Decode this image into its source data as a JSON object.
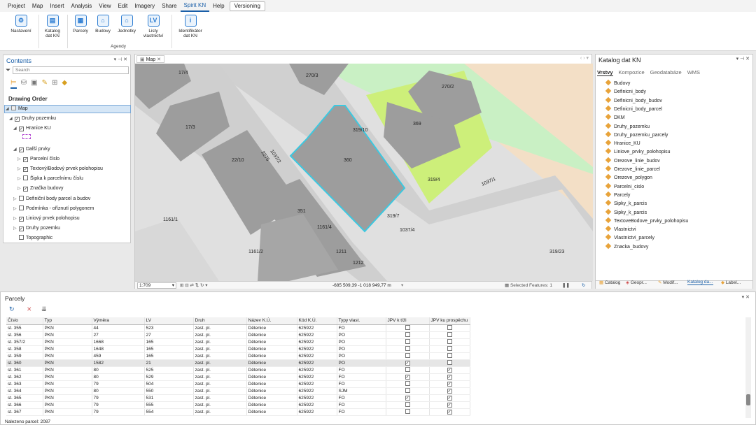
{
  "menu": [
    "Project",
    "Map",
    "Insert",
    "Analysis",
    "View",
    "Edit",
    "Imagery",
    "Share",
    "Spirit KN",
    "Help"
  ],
  "menu_active": "Spirit KN",
  "menu_extra": "Versioning",
  "ribbon": {
    "nastaveni": "Nastavení",
    "katalog": "Katalog dat KN",
    "parcely": "Parcely",
    "budovy": "Budovy",
    "jednotky": "Jednotky",
    "listy": "Listy vlastnictví",
    "identifikator": "Identifikátor dat KN",
    "group_agendy": "Agendy"
  },
  "contents": {
    "title": "Contents",
    "search_placeholder": "Search",
    "drawing_order": "Drawing Order",
    "items": {
      "map": "Map",
      "druhy": "Druhy pozemku",
      "hranice": "Hranice KU",
      "dalsi": "Další prvky",
      "parcelni": "Parcelní číslo",
      "textovy": "Textový/Bodový prvek polohopisu",
      "sipka": "Šipka k parcelnímu číslu",
      "znacka": "Značka budovy",
      "definicni": "Definiční body parcel a budov",
      "podminka": "Podmínka - oříznutí polygonem",
      "liniovy": "Liniový prvek polohopisu",
      "druhy2": "Druhy pozemku",
      "topo": "Topographic"
    }
  },
  "map": {
    "tab": "Map",
    "scale": "1:709",
    "coords": "-685 509,39 -1 018 949,77 m",
    "selected": "Selected Features: 1",
    "labels": [
      "17/4",
      "270/3",
      "270/2",
      "17/3",
      "369",
      "319/10",
      "1037/2",
      "22/10",
      "2275",
      "360",
      "319/4",
      "1037/1",
      "1161/1",
      "351",
      "319/7",
      "1037/4",
      "1161/4",
      "1161/2",
      "1211",
      "1212",
      "319/23"
    ]
  },
  "catalog": {
    "title": "Katalog dat KN",
    "tabs": [
      "Vrstvy",
      "Kompozice",
      "Geodatabáze",
      "WMS"
    ],
    "items": [
      "Budovy",
      "Definicni_body",
      "Definicni_body_budov",
      "Definicni_body_parcel",
      "DKM",
      "Druhy_pozemku",
      "Druhy_pozemku_parcely",
      "Hranice_KU",
      "Liniove_prvky_polohopisu",
      "Orezove_linie_budov",
      "Orezove_linie_parcel",
      "Orezove_polygon",
      "Parcelni_cislo",
      "Parcely",
      "Sipky_k_parcis",
      "Sipky_k_parcis",
      "TextoveBodove_prvky_polohopisu",
      "Vlastnictvi",
      "Vlastnictvi_parcely",
      "Znacka_budovy"
    ],
    "bottom_tabs": [
      "Catalog",
      "Geopr...",
      "Modif...",
      "Katalog da...",
      "Label..."
    ]
  },
  "parcely": {
    "title": "Parcely",
    "columns": [
      "Číslo",
      "Typ",
      "Výměra",
      "LV",
      "Druh",
      "Název K.Ú.",
      "Kód K.Ú.",
      "Typy vlast.",
      "JPV k tíži",
      "JPV ku prospěchu"
    ],
    "rows": [
      [
        "st. 355",
        "PKN",
        "44",
        "523",
        "zast. pl.",
        "Dětenice",
        "625922",
        "FO",
        false,
        false
      ],
      [
        "st. 356",
        "PKN",
        "27",
        "27",
        "zast. pl.",
        "Dětenice",
        "625922",
        "PO",
        false,
        false
      ],
      [
        "st. 357/2",
        "PKN",
        "1668",
        "165",
        "zast. pl.",
        "Dětenice",
        "625922",
        "PO",
        false,
        false
      ],
      [
        "st. 358",
        "PKN",
        "1648",
        "165",
        "zast. pl.",
        "Dětenice",
        "625922",
        "PO",
        false,
        false
      ],
      [
        "st. 359",
        "PKN",
        "459",
        "165",
        "zast. pl.",
        "Dětenice",
        "625922",
        "PO",
        false,
        false
      ],
      [
        "st. 360",
        "PKN",
        "1582",
        "21",
        "zast. pl.",
        "Dětenice",
        "625922",
        "PO",
        true,
        false
      ],
      [
        "st. 361",
        "PKN",
        "80",
        "525",
        "zast. pl.",
        "Dětenice",
        "625922",
        "FO",
        false,
        true
      ],
      [
        "st. 362",
        "PKN",
        "80",
        "529",
        "zast. pl.",
        "Dětenice",
        "625922",
        "FO",
        true,
        true
      ],
      [
        "st. 363",
        "PKN",
        "79",
        "504",
        "zast. pl.",
        "Dětenice",
        "625922",
        "FO",
        false,
        true
      ],
      [
        "st. 364",
        "PKN",
        "80",
        "550",
        "zast. pl.",
        "Dětenice",
        "625922",
        "SJM",
        false,
        true
      ],
      [
        "st. 365",
        "PKN",
        "79",
        "531",
        "zast. pl.",
        "Dětenice",
        "625922",
        "FO",
        true,
        true
      ],
      [
        "st. 366",
        "PKN",
        "79",
        "555",
        "zast. pl.",
        "Dětenice",
        "625922",
        "FO",
        false,
        true
      ],
      [
        "st. 367",
        "PKN",
        "79",
        "554",
        "zast. pl.",
        "Dětenice",
        "625922",
        "FO",
        false,
        true
      ]
    ],
    "footer": "Nalezeno parcel: 2087"
  }
}
